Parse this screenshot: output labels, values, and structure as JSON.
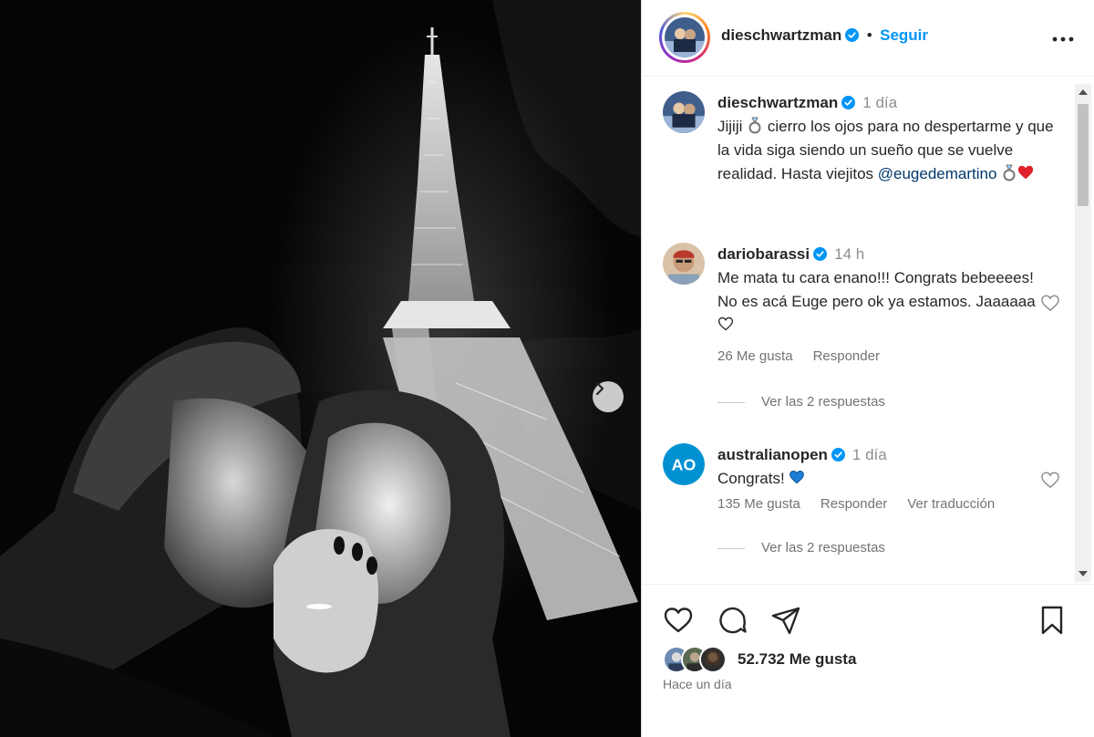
{
  "colors": {
    "accent": "#0095f6",
    "mention": "#00376b",
    "heart": "#ed4956",
    "verified": "#0095f6"
  },
  "post": {
    "image_alt_icons": [
      "eiffel-tower",
      "couple-kissing",
      "engagement-ring"
    ],
    "next_icon": "chevron-right-icon"
  },
  "header": {
    "username": "dieschwartzman",
    "follow_label": "Seguir",
    "more_icon": "more-horizontal-icon"
  },
  "caption": {
    "username": "dieschwartzman",
    "time": "1 día",
    "text_1": "Jijiji",
    "text_2": "cierro los ojos para no despertarme y que la vida siga siendo un sueño que se vuelve realidad. Hasta viejitos",
    "mention": "@eugedemartino"
  },
  "comments": [
    {
      "username": "dariobarassi",
      "time": "14 h",
      "text": "Me mata tu cara enano!!! Congrats bebeeees! No es acá Euge pero ok ya estamos. Jaaaaaa",
      "likes": "26 Me gusta",
      "reply": "Responder",
      "view_replies": "Ver las 2 respuestas"
    },
    {
      "username": "australianopen",
      "avatar_text": "AO",
      "time": "1 día",
      "text": "Congrats!",
      "likes": "135 Me gusta",
      "reply": "Responder",
      "translate": "Ver traducción",
      "view_replies": "Ver las 2 respuestas"
    }
  ],
  "actions": {
    "like_icon": "heart-icon",
    "comment_icon": "comment-icon",
    "share_icon": "send-icon",
    "save_icon": "bookmark-icon",
    "likes_count": "52.732 Me gusta",
    "posted_ago": "Hace un día"
  }
}
